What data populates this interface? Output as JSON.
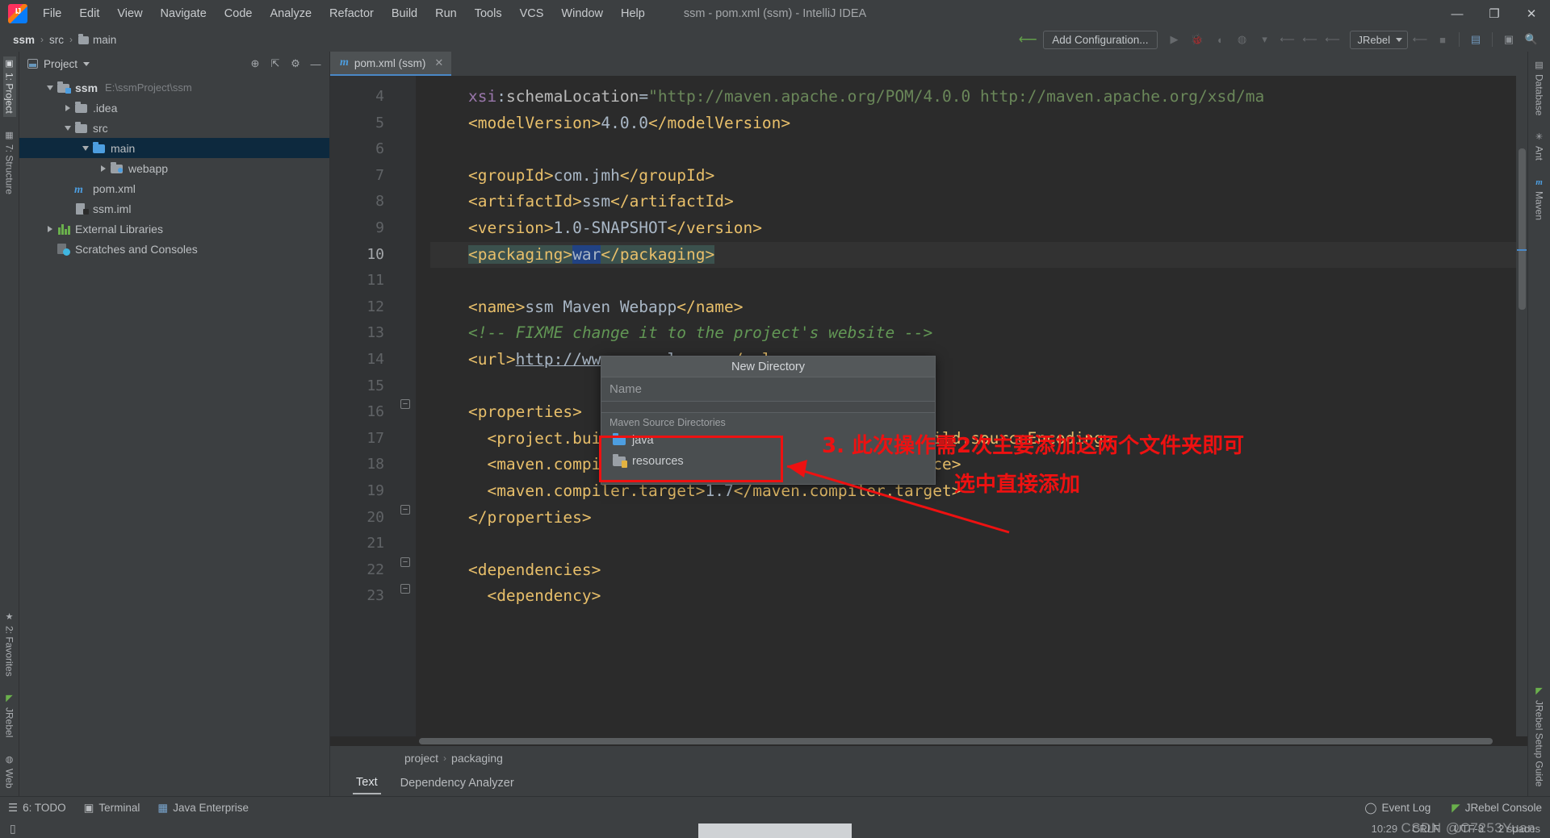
{
  "window": {
    "title": "ssm - pom.xml (ssm) - IntelliJ IDEA",
    "minimize": "—",
    "maximize": "❐",
    "close": "✕"
  },
  "menu": [
    {
      "label": "File"
    },
    {
      "label": "Edit"
    },
    {
      "label": "View"
    },
    {
      "label": "Navigate"
    },
    {
      "label": "Code"
    },
    {
      "label": "Analyze"
    },
    {
      "label": "Refactor"
    },
    {
      "label": "Build"
    },
    {
      "label": "Run"
    },
    {
      "label": "Tools"
    },
    {
      "label": "VCS"
    },
    {
      "label": "Window"
    },
    {
      "label": "Help"
    }
  ],
  "navbar": {
    "breadcrumbs": [
      {
        "label": "ssm",
        "bold": true
      },
      {
        "label": "src",
        "bold": false
      },
      {
        "label": "main",
        "bold": false,
        "icon": "folder-icon"
      }
    ],
    "add_configuration": "Add Configuration...",
    "jrebel_label": "JRebel",
    "icons": [
      "build-hammer-icon",
      "run-icon",
      "debug-icon",
      "run-with-coverage-icon",
      "profile-icon",
      "dropdown-icon",
      "jrebel-run-icon",
      "jrebel-debug-icon",
      "jrebel-coverage-icon",
      "jrebel-stop-icon",
      "stop-icon",
      "project-structure-icon",
      "terminal-icon",
      "search-everywhere-icon"
    ]
  },
  "left_rail": {
    "top": [
      {
        "label": "1: Project",
        "icon": "project-icon",
        "active": true
      },
      {
        "label": "7: Structure",
        "icon": "structure-icon",
        "active": false
      }
    ],
    "bottom": [
      {
        "label": "2: Favorites",
        "icon": "star-icon"
      },
      {
        "label": "JRebel",
        "icon": "jrebel-icon"
      },
      {
        "label": "Web",
        "icon": "web-icon"
      }
    ]
  },
  "project_panel": {
    "title": "Project",
    "actions": [
      "locate-icon",
      "collapse-all-icon",
      "settings-gear-icon",
      "hide-icon"
    ],
    "tree": [
      {
        "depth": 0,
        "arrow": "down",
        "icon": "module-folder-icon",
        "label": "ssm",
        "bold": true,
        "path": "E:\\ssmProject\\ssm",
        "selected": false
      },
      {
        "depth": 1,
        "arrow": "right",
        "icon": "folder-icon",
        "label": ".idea",
        "bold": false,
        "path": "",
        "selected": false
      },
      {
        "depth": 1,
        "arrow": "down",
        "icon": "folder-icon",
        "label": "src",
        "bold": false,
        "path": "",
        "selected": false
      },
      {
        "depth": 2,
        "arrow": "down",
        "icon": "folder-blue-icon",
        "label": "main",
        "bold": false,
        "path": "",
        "selected": true
      },
      {
        "depth": 3,
        "arrow": "right",
        "icon": "webapp-folder-icon",
        "label": "webapp",
        "bold": false,
        "path": "",
        "selected": false
      },
      {
        "depth": 2,
        "arrow": "none",
        "icon": "maven-xml-icon",
        "label": "pom.xml",
        "bold": false,
        "path": "",
        "selected": false
      },
      {
        "depth": 2,
        "arrow": "none",
        "icon": "iml-file-icon",
        "label": "ssm.iml",
        "bold": false,
        "path": "",
        "selected": false
      },
      {
        "depth": 0,
        "arrow": "right",
        "icon": "external-libraries-icon",
        "label": "External Libraries",
        "bold": false,
        "path": "",
        "selected": false
      },
      {
        "depth": 0,
        "arrow": "none",
        "icon": "scratches-icon",
        "label": "Scratches and Consoles",
        "bold": false,
        "path": "",
        "selected": false
      }
    ]
  },
  "editor": {
    "tab": {
      "label": "pom.xml (ssm)",
      "icon": "maven-xml-icon",
      "close": "✕"
    },
    "first_line_number": 4,
    "highlighted_line": 10,
    "lines": [
      {
        "n": 4,
        "html": "    <span class='ns'>xsi</span><span class='txt'>:</span><span class='attr'>schemaLocation</span><span class='txt'>=</span><span class='str'>\"http://maven.apache.org/POM/4.0.0 http://maven.apache.org/xsd/ma</span>"
      },
      {
        "n": 5,
        "html": "    <span class='tag'>&lt;modelVersion&gt;</span><span class='txt'>4.0.0</span><span class='tag'>&lt;/modelVersion&gt;</span>"
      },
      {
        "n": 6,
        "html": ""
      },
      {
        "n": 7,
        "html": "    <span class='tag'>&lt;groupId&gt;</span><span class='txt'>com.jmh</span><span class='tag'>&lt;/groupId&gt;</span>"
      },
      {
        "n": 8,
        "html": "    <span class='tag'>&lt;artifactId&gt;</span><span class='txt'>ssm</span><span class='tag'>&lt;/artifactId&gt;</span>"
      },
      {
        "n": 9,
        "html": "    <span class='tag'>&lt;version&gt;</span><span class='txt'>1.0-SNAPSHOT</span><span class='tag'>&lt;/version&gt;</span>"
      },
      {
        "n": 10,
        "html": "    <span class='tag hlbg'>&lt;packaging&gt;</span><span class='txt usel'>war</span><span class='tag hlbg'>&lt;/packaging&gt;</span>"
      },
      {
        "n": 11,
        "html": ""
      },
      {
        "n": 12,
        "html": "    <span class='tag'>&lt;name&gt;</span><span class='txt'>ssm Maven Webapp</span><span class='tag'>&lt;/name&gt;</span>"
      },
      {
        "n": 13,
        "html": "    <span class='cmt'>&lt;!-- FIXME change it to the project's website --&gt;</span>"
      },
      {
        "n": 14,
        "html": "    <span class='tag'>&lt;url&gt;</span><span class='txt link'>http://www.example.com</span><span class='tag'>&lt;/url&gt;</span>"
      },
      {
        "n": 15,
        "html": ""
      },
      {
        "n": 16,
        "html": "    <span class='tag'>&lt;properties&gt;</span>"
      },
      {
        "n": 17,
        "html": "      <span class='tag'>&lt;project.build.sourceEncoding&gt;</span><span class='txt'>UTF-8</span><span class='tag'>&lt;/project.build.sourceEncoding&gt;</span>"
      },
      {
        "n": 18,
        "html": "      <span class='tag'>&lt;maven.compiler.source&gt;</span><span class='txt'>1.7</span><span class='tag'>&lt;/maven.compiler.source&gt;</span>"
      },
      {
        "n": 19,
        "html": "      <span class='tag'>&lt;maven.compiler.target&gt;</span><span class='txt'>1.7</span><span class='tag'>&lt;/maven.compiler.target&gt;</span>"
      },
      {
        "n": 20,
        "html": "    <span class='tag'>&lt;/properties&gt;</span>"
      },
      {
        "n": 21,
        "html": ""
      },
      {
        "n": 22,
        "html": "    <span class='tag'>&lt;dependencies&gt;</span>"
      },
      {
        "n": 23,
        "html": "      <span class='tag'>&lt;dependency&gt;</span>"
      }
    ],
    "breadcrumbs": [
      {
        "label": "project"
      },
      {
        "label": "packaging"
      }
    ],
    "bottom_tabs": [
      {
        "label": "Text",
        "active": true
      },
      {
        "label": "Dependency Analyzer",
        "active": false
      }
    ]
  },
  "new_directory_dialog": {
    "title": "New Directory",
    "name_placeholder": "Name",
    "name_value": "",
    "section_label": "Maven Source Directories",
    "items": [
      {
        "label": "java",
        "icon": "source-folder-icon"
      },
      {
        "label": "resources",
        "icon": "resources-folder-icon"
      }
    ]
  },
  "annotations": {
    "line1": "3. 此次操作需2次主要添加这两个文件夹即可",
    "line2": "选中直接添加",
    "color": "#ee1111"
  },
  "right_rail": {
    "top": [
      {
        "label": "Database",
        "icon": "database-icon"
      },
      {
        "label": "Ant",
        "icon": "ant-icon"
      },
      {
        "label": "Maven",
        "icon": "maven-icon"
      }
    ],
    "bottom": [
      {
        "label": "JRebel Setup Guide",
        "icon": "jrebel-icon"
      }
    ]
  },
  "tool_windows": {
    "left": [
      {
        "label": "6: TODO",
        "icon": "todo-icon"
      },
      {
        "label": "Terminal",
        "icon": "terminal-icon"
      },
      {
        "label": "Java Enterprise",
        "icon": "java-enterprise-icon"
      }
    ],
    "right": [
      {
        "label": "Event Log",
        "icon": "event-log-icon"
      },
      {
        "label": "JRebel Console",
        "icon": "jrebel-icon"
      }
    ]
  },
  "status_bar": {
    "left_icon": "line-separator-icon",
    "time": "10:29",
    "line_separator": "CRLF",
    "encoding": "UTF-8",
    "indent": "2 spaces",
    "branch": "",
    "watermark": "CSDN @C7253Yuan"
  }
}
